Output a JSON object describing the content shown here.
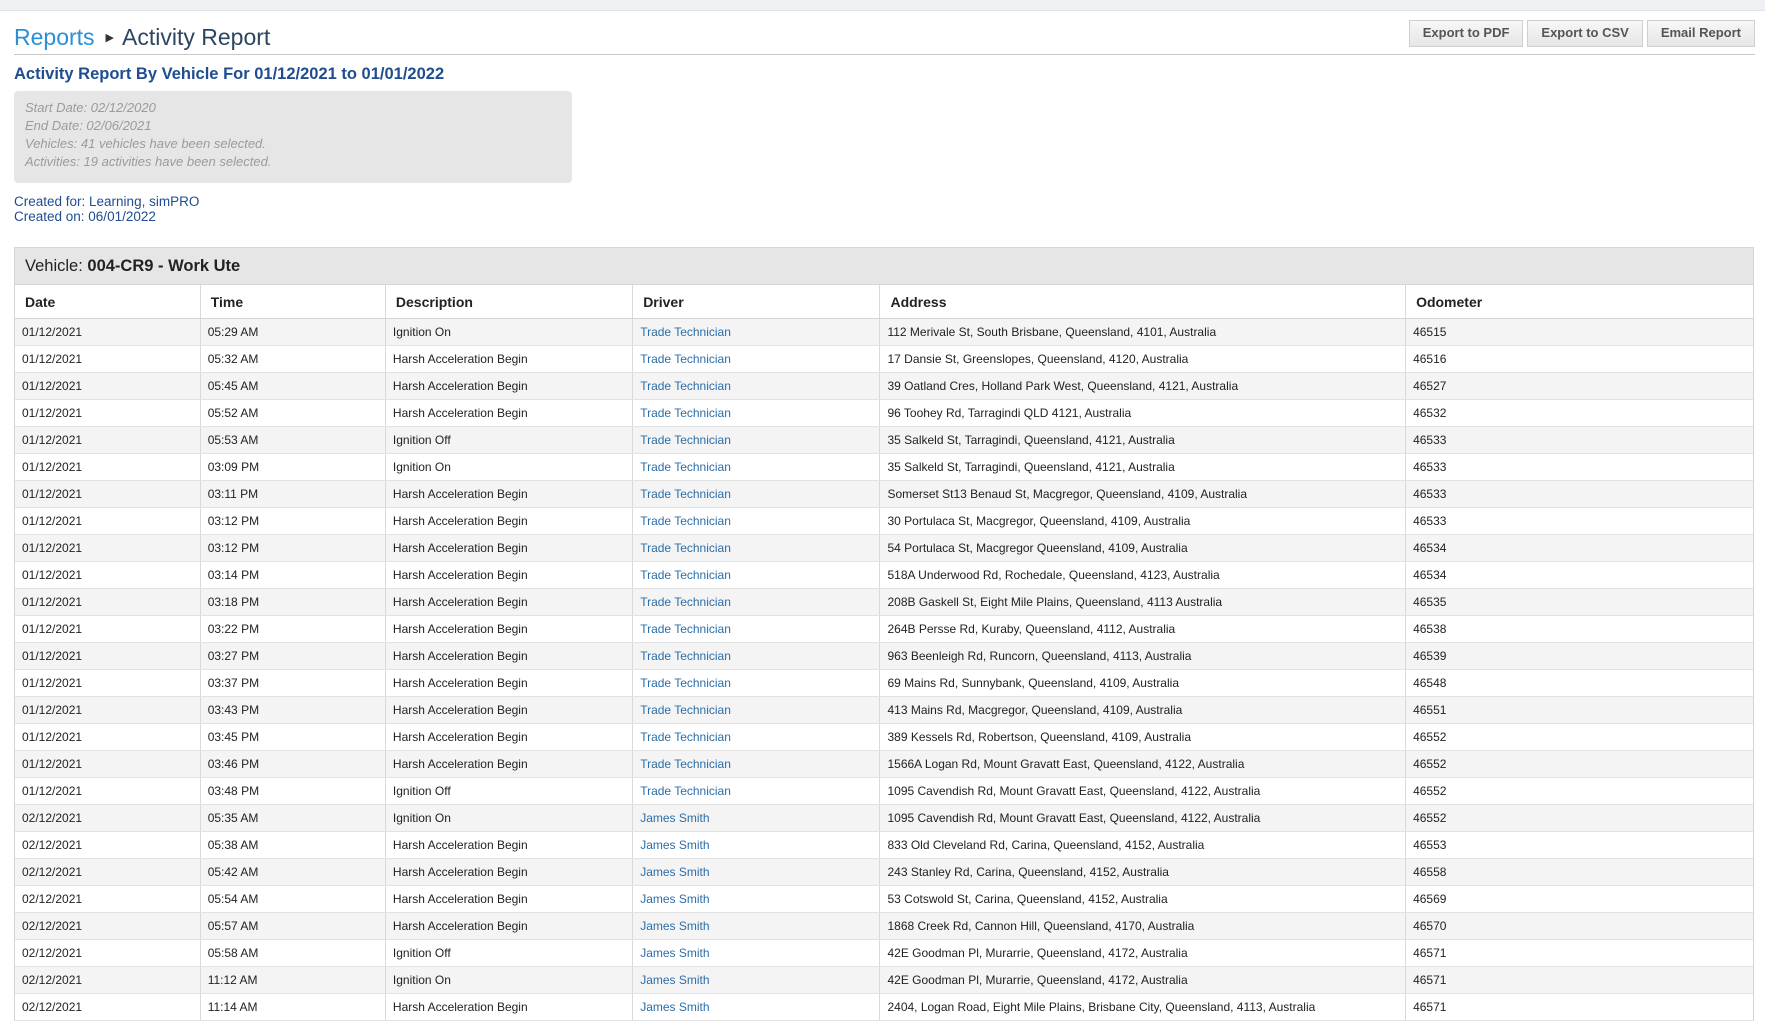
{
  "breadcrumb": {
    "root": "Reports",
    "current": "Activity Report"
  },
  "actions": {
    "export_pdf": "Export to PDF",
    "export_csv": "Export to CSV",
    "email": "Email Report"
  },
  "report_title": "Activity Report By Vehicle For 01/12/2021 to 01/01/2022",
  "criteria": {
    "start_date": "Start Date: 02/12/2020",
    "end_date": "End Date: 02/06/2021",
    "vehicles": "Vehicles: 41 vehicles have been selected.",
    "activities": "Activities: 19 activities have been selected."
  },
  "created": {
    "for": "Created for: Learning, simPRO",
    "on": "Created on: 06/01/2022"
  },
  "vehicle": {
    "label": "Vehicle:",
    "name": "004-CR9 - Work Ute"
  },
  "table": {
    "columns": [
      "Date",
      "Time",
      "Description",
      "Driver",
      "Address",
      "Odometer"
    ],
    "rows": [
      [
        "01/12/2021",
        "05:29 AM",
        "Ignition On",
        "Trade Technician",
        "112 Merivale St, South Brisbane, Queensland, 4101, Australia",
        "46515"
      ],
      [
        "01/12/2021",
        "05:32 AM",
        "Harsh Acceleration Begin",
        "Trade Technician",
        "17 Dansie St, Greenslopes, Queensland, 4120, Australia",
        "46516"
      ],
      [
        "01/12/2021",
        "05:45 AM",
        "Harsh Acceleration Begin",
        "Trade Technician",
        "39 Oatland Cres, Holland Park West, Queensland, 4121, Australia",
        "46527"
      ],
      [
        "01/12/2021",
        "05:52 AM",
        "Harsh Acceleration Begin",
        "Trade Technician",
        "96 Toohey Rd, Tarragindi QLD 4121, Australia",
        "46532"
      ],
      [
        "01/12/2021",
        "05:53 AM",
        "Ignition Off",
        "Trade Technician",
        "35 Salkeld St, Tarragindi, Queensland, 4121, Australia",
        "46533"
      ],
      [
        "01/12/2021",
        "03:09 PM",
        "Ignition On",
        "Trade Technician",
        "35 Salkeld St, Tarragindi, Queensland, 4121, Australia",
        "46533"
      ],
      [
        "01/12/2021",
        "03:11 PM",
        "Harsh Acceleration Begin",
        "Trade Technician",
        "Somerset St13 Benaud St, Macgregor, Queensland, 4109, Australia",
        "46533"
      ],
      [
        "01/12/2021",
        "03:12 PM",
        "Harsh Acceleration Begin",
        "Trade Technician",
        "30 Portulaca St, Macgregor, Queensland, 4109, Australia",
        "46533"
      ],
      [
        "01/12/2021",
        "03:12 PM",
        "Harsh Acceleration Begin",
        "Trade Technician",
        "54 Portulaca St, Macgregor Queensland, 4109, Australia",
        "46534"
      ],
      [
        "01/12/2021",
        "03:14 PM",
        "Harsh Acceleration Begin",
        "Trade Technician",
        "518A Underwood Rd, Rochedale, Queensland, 4123, Australia",
        "46534"
      ],
      [
        "01/12/2021",
        "03:18 PM",
        "Harsh Acceleration Begin",
        "Trade Technician",
        "208B Gaskell St, Eight Mile Plains, Queensland, 4113 Australia",
        "46535"
      ],
      [
        "01/12/2021",
        "03:22 PM",
        "Harsh Acceleration Begin",
        "Trade Technician",
        "264B Persse Rd, Kuraby, Queensland, 4112, Australia",
        "46538"
      ],
      [
        "01/12/2021",
        "03:27 PM",
        "Harsh Acceleration Begin",
        "Trade Technician",
        "963 Beenleigh Rd, Runcorn, Queensland, 4113, Australia",
        "46539"
      ],
      [
        "01/12/2021",
        "03:37 PM",
        "Harsh Acceleration Begin",
        "Trade Technician",
        "69 Mains Rd, Sunnybank, Queensland, 4109, Australia",
        "46548"
      ],
      [
        "01/12/2021",
        "03:43 PM",
        "Harsh Acceleration Begin",
        "Trade Technician",
        "413 Mains Rd, Macgregor, Queensland, 4109, Australia",
        "46551"
      ],
      [
        "01/12/2021",
        "03:45 PM",
        "Harsh Acceleration Begin",
        "Trade Technician",
        "389 Kessels Rd, Robertson, Queensland, 4109, Australia",
        "46552"
      ],
      [
        "01/12/2021",
        "03:46 PM",
        "Harsh Acceleration Begin",
        "Trade Technician",
        "1566A Logan Rd, Mount Gravatt East, Queensland, 4122, Australia",
        "46552"
      ],
      [
        "01/12/2021",
        "03:48 PM",
        "Ignition Off",
        "Trade Technician",
        "1095 Cavendish Rd, Mount Gravatt East, Queensland, 4122, Australia",
        "46552"
      ],
      [
        "02/12/2021",
        "05:35 AM",
        "Ignition On",
        "James Smith",
        "1095 Cavendish Rd, Mount Gravatt East, Queensland, 4122, Australia",
        "46552"
      ],
      [
        "02/12/2021",
        "05:38 AM",
        "Harsh Acceleration Begin",
        "James Smith",
        "833 Old Cleveland Rd, Carina, Queensland, 4152, Australia",
        "46553"
      ],
      [
        "02/12/2021",
        "05:42 AM",
        "Harsh Acceleration Begin",
        "James Smith",
        "243 Stanley Rd, Carina, Queensland, 4152, Australia",
        "46558"
      ],
      [
        "02/12/2021",
        "05:54 AM",
        "Harsh Acceleration Begin",
        "James Smith",
        "53 Cotswold St, Carina, Queensland, 4152, Australia",
        "46569"
      ],
      [
        "02/12/2021",
        "05:57 AM",
        "Harsh Acceleration Begin",
        "James Smith",
        "1868 Creek Rd, Cannon Hill, Queensland, 4170, Australia",
        "46570"
      ],
      [
        "02/12/2021",
        "05:58 AM",
        "Ignition Off",
        "James Smith",
        "42E Goodman Pl, Murarrie, Queensland, 4172, Australia",
        "46571"
      ],
      [
        "02/12/2021",
        "11:12 AM",
        "Ignition On",
        "James Smith",
        "42E Goodman Pl, Murarrie, Queensland, 4172, Australia",
        "46571"
      ],
      [
        "02/12/2021",
        "11:14 AM",
        "Harsh Acceleration Begin",
        "James Smith",
        "2404, Logan Road, Eight Mile Plains, Brisbane City, Queensland, 4113, Australia",
        "46571"
      ]
    ]
  }
}
